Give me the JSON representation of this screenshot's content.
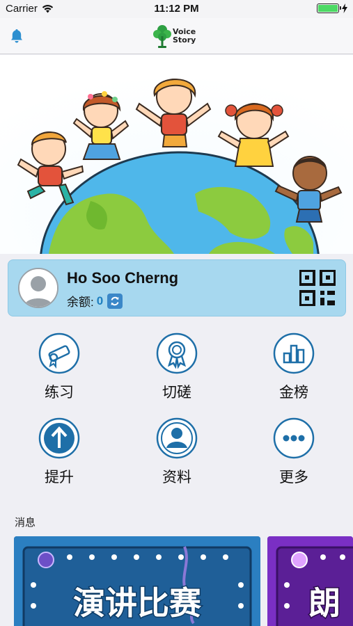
{
  "status_bar": {
    "carrier": "Carrier",
    "time": "11:12 PM",
    "battery_level": 1.0
  },
  "nav": {
    "logo_line1": "Voice",
    "logo_line2": "Story"
  },
  "profile": {
    "name": "Ho Soo Cherng",
    "balance_label": "余额:",
    "balance_value": "0"
  },
  "menu": [
    {
      "label": "练习",
      "icon": "diploma-scroll-icon"
    },
    {
      "label": "切磋",
      "icon": "award-ribbon-icon"
    },
    {
      "label": "金榜",
      "icon": "bar-chart-icon"
    },
    {
      "label": "提升",
      "icon": "arrow-up-icon"
    },
    {
      "label": "资料",
      "icon": "user-profile-icon"
    },
    {
      "label": "更多",
      "icon": "more-dots-icon"
    }
  ],
  "messages": {
    "title": "消息",
    "cards": [
      {
        "text": "演讲比赛",
        "color": "#2b7fc1"
      },
      {
        "text": "朗",
        "color": "#7a2fc4"
      }
    ]
  },
  "colors": {
    "accent": "#1e6fa8",
    "card_bg": "#a7d8ef"
  }
}
